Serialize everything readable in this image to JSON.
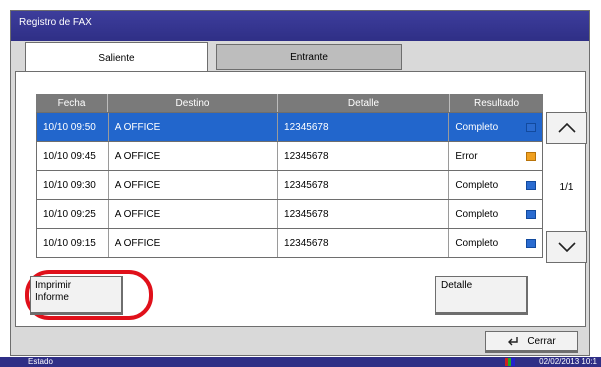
{
  "window": {
    "title": "Registro de FAX"
  },
  "tabs": [
    {
      "label": "Saliente",
      "active": true
    },
    {
      "label": "Entrante",
      "active": false
    }
  ],
  "table": {
    "headers": [
      "Fecha",
      "Destino",
      "Detalle",
      "Resultado"
    ],
    "rows": [
      {
        "fecha": "10/10 09:50",
        "destino": "A OFFICE",
        "detalle": "12345678",
        "resultado": "Completo",
        "icon": "ok-icon",
        "selected": true
      },
      {
        "fecha": "10/10 09:45",
        "destino": "A OFFICE",
        "detalle": "12345678",
        "resultado": "Error",
        "icon": "error-icon",
        "selected": false
      },
      {
        "fecha": "10/10 09:30",
        "destino": "A OFFICE",
        "detalle": "12345678",
        "resultado": "Completo",
        "icon": "ok-icon",
        "selected": false
      },
      {
        "fecha": "10/10 09:25",
        "destino": "A OFFICE",
        "detalle": "12345678",
        "resultado": "Completo",
        "icon": "ok-icon",
        "selected": false
      },
      {
        "fecha": "10/10 09:15",
        "destino": "A OFFICE",
        "detalle": "12345678",
        "resultado": "Completo",
        "icon": "ok-icon",
        "selected": false
      }
    ]
  },
  "pager": {
    "page": "1/1"
  },
  "buttons": {
    "imprimir_line1": "Imprimir",
    "imprimir_line2": "Informe",
    "detalle": "Detalle",
    "cerrar": "Cerrar"
  },
  "statusbar": {
    "label": "Estado",
    "datetime": "02/02/2013 10:1"
  },
  "colors": {
    "selected_row": "#2266cc",
    "titlebar": "#2f2f86",
    "highlight": "#e0101a"
  }
}
